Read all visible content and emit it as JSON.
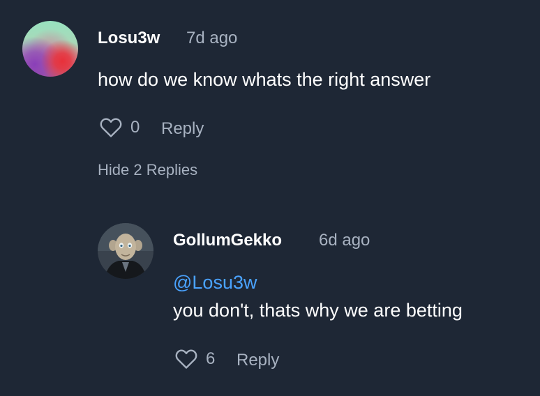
{
  "comments": [
    {
      "username": "Losu3w",
      "time": "7d ago",
      "text": "how do we know whats the right answer",
      "likes": "0",
      "reply_label": "Reply",
      "replies_toggle": "Hide 2 Replies"
    }
  ],
  "replies": [
    {
      "username": "GollumGekko",
      "time": "6d ago",
      "mention": "@Losu3w",
      "text": "you don't, thats why we are betting",
      "likes": "6",
      "reply_label": "Reply"
    }
  ],
  "colors": {
    "background": "#1e2735",
    "text": "#ffffff",
    "muted": "#a8b2c1",
    "mention": "#4aa3ff"
  },
  "icons": {
    "like": "heart-icon",
    "avatar_reply": "gollum-avatar"
  }
}
